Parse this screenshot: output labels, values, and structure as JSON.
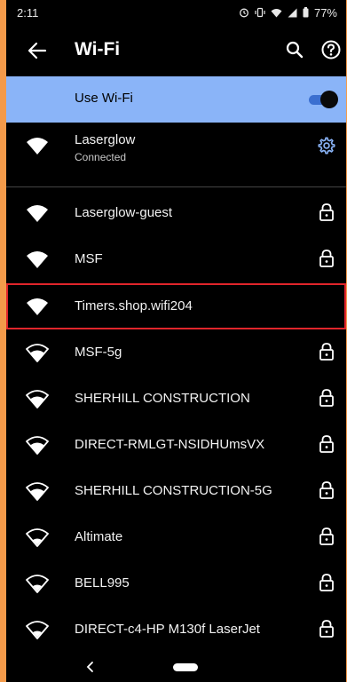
{
  "statusbar": {
    "time": "2:11",
    "battery": "77%"
  },
  "appbar": {
    "title": "Wi-Fi"
  },
  "use_wifi": {
    "label": "Use Wi-Fi",
    "enabled": true
  },
  "networks": [
    {
      "name": "Laserglow",
      "status": "Connected",
      "signal_icon": "wifi-filled-icon",
      "trailing_icon": "gear-icon"
    },
    {
      "name": "Laserglow-guest",
      "signal_icon": "wifi-filled-icon",
      "trailing_icon": "lock-icon"
    },
    {
      "name": "MSF",
      "signal_icon": "wifi-filled-icon",
      "trailing_icon": "lock-icon"
    },
    {
      "name": "Timers.shop.wifi204",
      "signal_icon": "wifi-filled-icon",
      "trailing_icon": ""
    },
    {
      "name": "MSF-5g",
      "signal_icon": "wifi-partial-icon",
      "trailing_icon": "lock-icon"
    },
    {
      "name": "SHERHILL CONSTRUCTION",
      "signal_icon": "wifi-partial-icon",
      "trailing_icon": "lock-icon"
    },
    {
      "name": "DIRECT-RMLGT-NSIDHUmsVX",
      "signal_icon": "wifi-partial-icon",
      "trailing_icon": "lock-icon"
    },
    {
      "name": "SHERHILL CONSTRUCTION-5G",
      "signal_icon": "wifi-partial-icon",
      "trailing_icon": "lock-icon"
    },
    {
      "name": "Altimate",
      "signal_icon": "wifi-outline-icon",
      "trailing_icon": "lock-icon"
    },
    {
      "name": "BELL995",
      "signal_icon": "wifi-outline-icon",
      "trailing_icon": "lock-icon"
    },
    {
      "name": "DIRECT-c4-HP M130f LaserJet",
      "signal_icon": "wifi-outline-icon",
      "trailing_icon": "lock-icon"
    }
  ],
  "colors": {
    "accent": "#8ab4f8",
    "highlight_border": "#e0252b",
    "gear": "#8ab4f8"
  }
}
